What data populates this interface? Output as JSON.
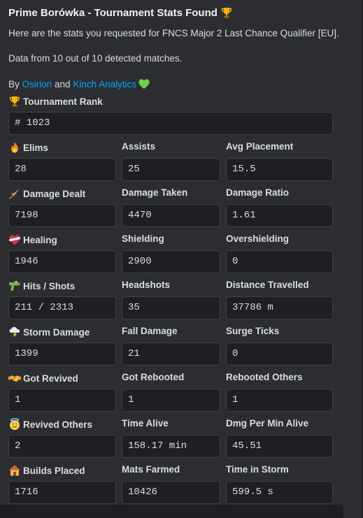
{
  "embed": {
    "title": "Prime Borówka - Tournament Stats Found",
    "title_icon": "trophy-icon",
    "description_line1": "Here are the stats you requested for FNCS Major 2 Last Chance Qualifier [EU].",
    "description_line2": "Data from 10 out of 10 detected matches.",
    "by_prefix": "By ",
    "credit_1": "Osirion",
    "by_and": " and ",
    "credit_2": "Kinch Analytics",
    "credit_icon": "green-heart-icon",
    "link_color": "#00a8fc",
    "accent_green": "#6fcf4a"
  },
  "rank": {
    "label": "Tournament Rank",
    "icon": "trophy-icon",
    "value": "# 1023"
  },
  "rows": [
    [
      {
        "label": "Elims",
        "icon": "fire-icon",
        "value": "28"
      },
      {
        "label": "Assists",
        "value": "25"
      },
      {
        "label": "Avg Placement",
        "value": "15.5"
      }
    ],
    [
      {
        "label": "Damage Dealt",
        "icon": "dagger-icon",
        "value": "7198"
      },
      {
        "label": "Damage Taken",
        "value": "4470"
      },
      {
        "label": "Damage Ratio",
        "value": "1.61"
      }
    ],
    [
      {
        "label": "Healing",
        "icon": "mending-heart-icon",
        "value": "1946"
      },
      {
        "label": "Shielding",
        "value": "2900"
      },
      {
        "label": "Overshielding",
        "value": "0"
      }
    ],
    [
      {
        "label": "Hits / Shots",
        "icon": "water-pistol-icon",
        "value": "211 / 2313"
      },
      {
        "label": "Headshots",
        "value": "35"
      },
      {
        "label": "Distance Travelled",
        "value": "37786 m"
      }
    ],
    [
      {
        "label": "Storm Damage",
        "icon": "storm-cloud-icon",
        "value": "1399"
      },
      {
        "label": "Fall Damage",
        "value": "21"
      },
      {
        "label": "Surge Ticks",
        "value": "0"
      }
    ],
    [
      {
        "label": "Got Revived",
        "icon": "handshake-icon",
        "value": "1"
      },
      {
        "label": "Got Rebooted",
        "value": "1"
      },
      {
        "label": "Rebooted Others",
        "value": "1"
      }
    ],
    [
      {
        "label": "Revived Others",
        "icon": "angel-face-icon",
        "value": "2"
      },
      {
        "label": "Time Alive",
        "value": "158.17 min"
      },
      {
        "label": "Dmg Per Min Alive",
        "value": "45.51"
      }
    ],
    [
      {
        "label": "Builds Placed",
        "icon": "house-icon",
        "value": "1716"
      },
      {
        "label": "Mats Farmed",
        "value": "10426"
      },
      {
        "label": "Time in Storm",
        "value": "599.5 s"
      }
    ]
  ]
}
